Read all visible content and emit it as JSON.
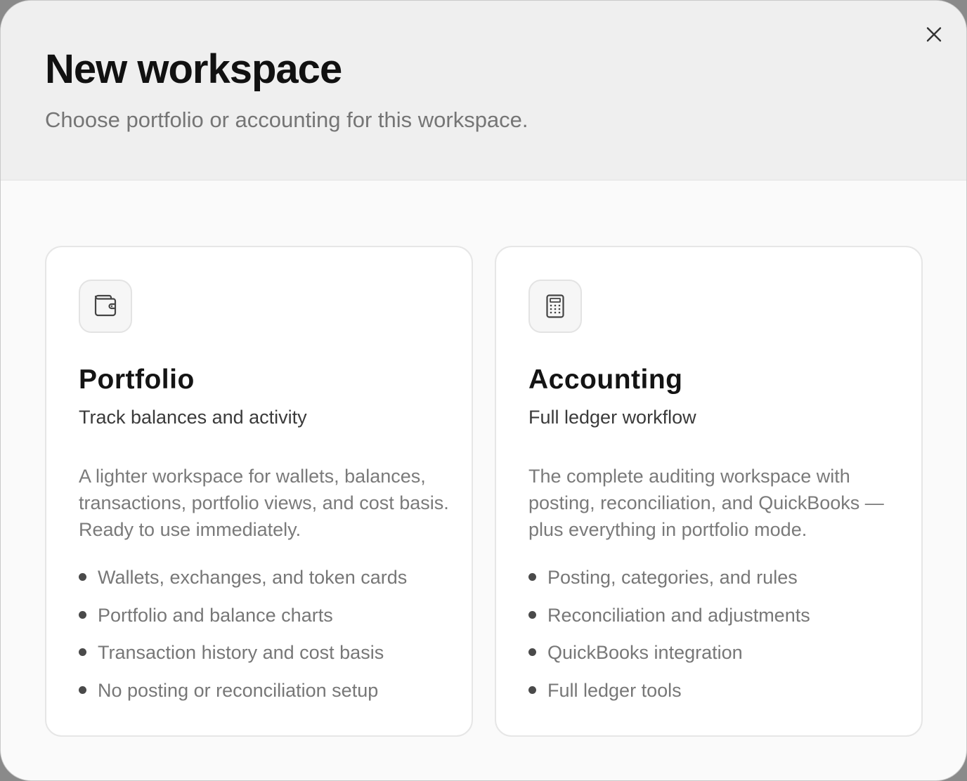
{
  "dialog": {
    "title": "New workspace",
    "subtitle": "Choose portfolio or accounting for this workspace.",
    "close_icon": "close-icon"
  },
  "options": [
    {
      "icon": "wallet-icon",
      "title": "Portfolio",
      "tagline": "Track balances and activity",
      "description": "A lighter workspace for wallets, balances, transactions, portfolio views, and cost basis. Ready to use immediately.",
      "features": [
        "Wallets, exchanges, and token cards",
        "Portfolio and balance charts",
        "Transaction history and cost basis",
        "No posting or reconciliation setup"
      ]
    },
    {
      "icon": "calculator-icon",
      "title": "Accounting",
      "tagline": "Full ledger workflow",
      "description": "The complete auditing workspace with posting, reconciliation, and QuickBooks — plus everything in portfolio mode.",
      "features": [
        "Posting, categories, and rules",
        "Reconciliation and adjustments",
        "QuickBooks integration",
        "Full ledger tools"
      ]
    }
  ],
  "colors": {
    "header_bg": "#efefef",
    "body_bg": "#fafafa",
    "card_bg": "#ffffff",
    "card_border": "#e6e6e6",
    "title_text": "#111111",
    "muted_text": "#777777"
  }
}
